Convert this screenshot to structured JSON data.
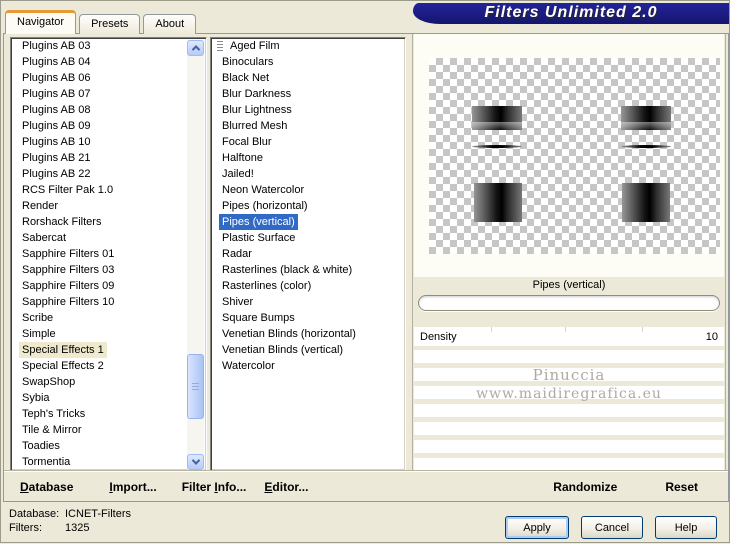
{
  "window": {
    "title": "Filters Unlimited 2.0"
  },
  "tabs": [
    {
      "label": "Navigator",
      "active": true
    },
    {
      "label": "Presets",
      "active": false
    },
    {
      "label": "About",
      "active": false
    }
  ],
  "category_list": {
    "selected": "Special Effects 1",
    "items": [
      "Plugins AB 03",
      "Plugins AB 04",
      "Plugins AB 06",
      "Plugins AB 07",
      "Plugins AB 08",
      "Plugins AB 09",
      "Plugins AB 10",
      "Plugins AB 21",
      "Plugins AB 22",
      "RCS Filter Pak 1.0",
      "Render",
      "Rorshack Filters",
      "Sabercat",
      "Sapphire Filters 01",
      "Sapphire Filters 03",
      "Sapphire Filters 09",
      "Sapphire Filters 10",
      "Scribe",
      "Simple",
      "Special Effects 1",
      "Special Effects 2",
      "SwapShop",
      "Sybia",
      "Teph's Tricks",
      "Tile & Mirror",
      "Toadies",
      "Tormentia"
    ]
  },
  "filter_list": {
    "selected": "Pipes (vertical)",
    "items": [
      "Aged Film",
      "Binoculars",
      "Black Net",
      "Blur Darkness",
      "Blur Lightness",
      "Blurred Mesh",
      "Focal Blur",
      "Halftone",
      "Jailed!",
      "Neon Watercolor",
      "Pipes (horizontal)",
      "Pipes (vertical)",
      "Plastic Surface",
      "Radar",
      "Rasterlines (black & white)",
      "Rasterlines (color)",
      "Shiver",
      "Square Bumps",
      "Venetian Blinds (horizontal)",
      "Venetian Blinds (vertical)",
      "Watercolor"
    ]
  },
  "preview": {
    "caption": "Pipes (vertical)",
    "watermark_line1": "Pinuccia",
    "watermark_line2": "www.maidiregrafica.eu"
  },
  "parameters": [
    {
      "name": "Density",
      "value": "10"
    }
  ],
  "toolbar": {
    "left": [
      {
        "label": "Database",
        "underline_index": 0
      },
      {
        "label": "Import...",
        "underline_index": 0
      },
      {
        "label": "Filter Info...",
        "underline_index": 7
      },
      {
        "label": "Editor...",
        "underline_index": 0
      }
    ],
    "right": [
      {
        "label": "Randomize",
        "underline_index": -1
      },
      {
        "label": "Reset",
        "underline_index": -1
      }
    ]
  },
  "status": {
    "database_label": "Database:",
    "database_value": "ICNET-Filters",
    "filters_label": "Filters:",
    "filters_value": "1325"
  },
  "action_buttons": {
    "apply": "Apply",
    "cancel": "Cancel",
    "help": "Help"
  },
  "colors": {
    "background": "#ece9d8",
    "banner": "#1b1b80",
    "selection_blue": "#316ac5",
    "selection_category": "#efe9cd",
    "tab_accent_orange": "#e79a34"
  }
}
